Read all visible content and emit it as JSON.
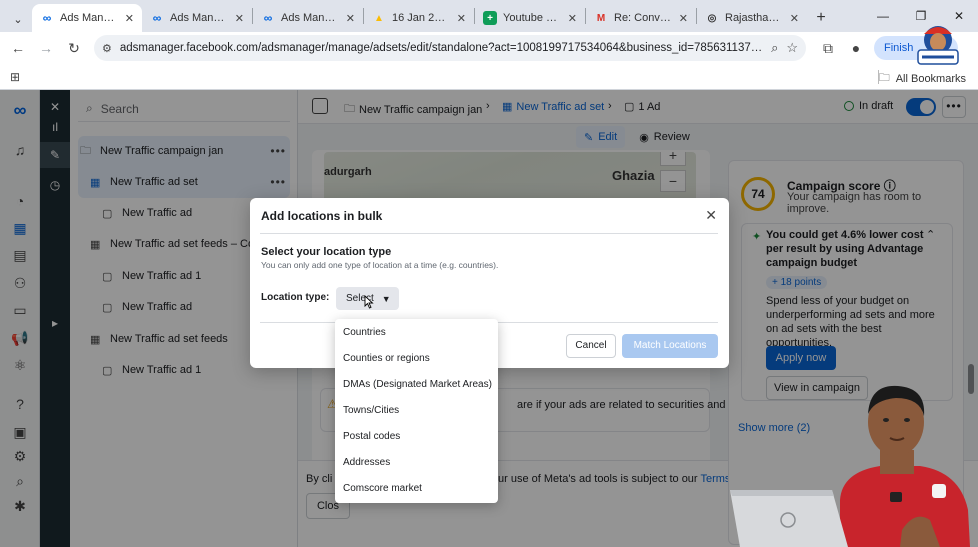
{
  "browser": {
    "tabs": [
      {
        "title": "Ads Manager",
        "icon": "meta-icon",
        "active": true
      },
      {
        "title": "Ads Manager",
        "icon": "meta-icon"
      },
      {
        "title": "Ads Manager",
        "icon": "meta-icon"
      },
      {
        "title": "16 Jan 2026 -",
        "icon": "drive-icon"
      },
      {
        "title": "Youtube vide",
        "icon": "sheets-icon"
      },
      {
        "title": "Re: Conversati",
        "icon": "gmail-icon"
      },
      {
        "title": "Rajasthan PIN",
        "icon": "pin-icon"
      }
    ],
    "url": "adsmanager.facebook.com/adsmanager/manage/adsets/edit/standalone?act=1008199717534064&business_id=785631137036741...",
    "finish_label": "Finish",
    "all_bookmarks": "All Bookmarks"
  },
  "tree": {
    "search_placeholder": "Search",
    "items": [
      {
        "label": "New Traffic campaign jan",
        "icon": "folder-icon",
        "more": "•••"
      },
      {
        "label": "New Traffic ad set",
        "icon": "adset-icon",
        "more": "•••"
      },
      {
        "label": "New Traffic ad",
        "icon": "ad-icon"
      },
      {
        "label": "New Traffic ad set feeds – Copy",
        "icon": "adset-outline-icon"
      },
      {
        "label": "New Traffic ad 1",
        "icon": "ad-icon"
      },
      {
        "label": "New Traffic ad",
        "icon": "ad-icon"
      },
      {
        "label": "New Traffic ad set feeds",
        "icon": "adset-outline-icon"
      },
      {
        "label": "New Traffic ad 1",
        "icon": "ad-icon"
      }
    ]
  },
  "topbar": {
    "crumb_campaign": "New Traffic campaign jan",
    "crumb_adset": "New Traffic ad set",
    "crumb_ad": "1 Ad",
    "status": "In draft",
    "edit_label": "Edit",
    "review_label": "Review"
  },
  "map": {
    "place_left": "adurgarh",
    "place_right": "Ghazia"
  },
  "warning_text": "are if your ads are related to securities and",
  "consent": {
    "prefix": "By cli",
    "text": "ur use of Meta's ad tools is subject to our ",
    "link": "Terms and Conditions.",
    "close_label": "Clos"
  },
  "score": {
    "value": "74",
    "title": "Campaign score",
    "subtitle": "Your campaign has room to improve.",
    "rec_title": "You could get 4.6% lower cost per result by using Advantage campaign budget",
    "points": "+ 18 points",
    "rec_body": "Spend less of your budget on underperforming ad sets and more on ad sets with the best opportunities.",
    "apply_label": "Apply now",
    "view_label": "View in campaign",
    "show_more": "Show more (2)"
  },
  "modal": {
    "title": "Add locations in bulk",
    "section_title": "Select your location type",
    "hint": "You can only add one type of location at a time (e.g. countries).",
    "location_type_label": "Location type:",
    "select_value": "Select",
    "cancel_label": "Cancel",
    "match_label": "Match Locations",
    "options": [
      "Countries",
      "Counties or regions",
      "DMAs (Designated Market Areas)",
      "Towns/Cities",
      "Postal codes",
      "Addresses",
      "Comscore market"
    ]
  },
  "colors": {
    "meta_blue": "#0a66d6",
    "dark_rail": "#1c2b33",
    "score_ring": "#f4b400"
  }
}
